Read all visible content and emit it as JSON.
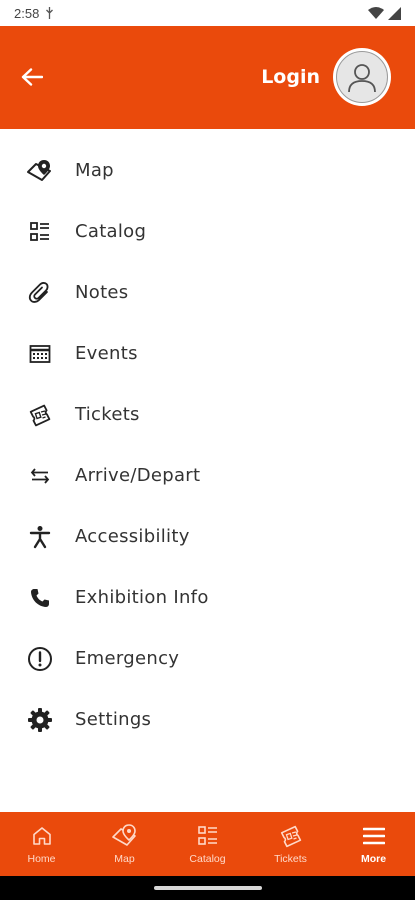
{
  "status_bar": {
    "time": "2:58"
  },
  "header": {
    "login_label": "Login"
  },
  "menu": {
    "items": [
      {
        "label": "Map",
        "icon": "map-pin-icon"
      },
      {
        "label": "Catalog",
        "icon": "catalog-icon"
      },
      {
        "label": "Notes",
        "icon": "paperclip-icon"
      },
      {
        "label": "Events",
        "icon": "calendar-icon"
      },
      {
        "label": "Tickets",
        "icon": "tickets-icon"
      },
      {
        "label": "Arrive/Depart",
        "icon": "swap-arrows-icon"
      },
      {
        "label": "Accessibility",
        "icon": "accessibility-icon"
      },
      {
        "label": "Exhibition Info",
        "icon": "phone-icon"
      },
      {
        "label": "Emergency",
        "icon": "alert-icon"
      },
      {
        "label": "Settings",
        "icon": "gear-icon"
      }
    ]
  },
  "bottom_nav": {
    "items": [
      {
        "label": "Home",
        "icon": "home-icon"
      },
      {
        "label": "Map",
        "icon": "map-pin-icon"
      },
      {
        "label": "Catalog",
        "icon": "catalog-icon"
      },
      {
        "label": "Tickets",
        "icon": "tickets-icon"
      },
      {
        "label": "More",
        "icon": "menu-icon",
        "active": true
      }
    ]
  },
  "colors": {
    "accent": "#EA4A0C",
    "nav_inactive": "#FFD9C9"
  }
}
